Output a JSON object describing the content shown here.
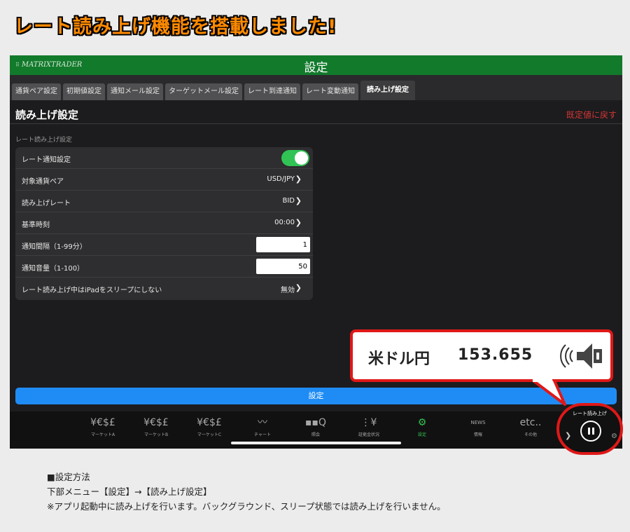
{
  "headline": "レート読み上げ機能を搭載しました!",
  "app": {
    "logo": "MATRIXTRADER",
    "title": "設定"
  },
  "tabs": [
    {
      "label": "通貨ペア設定"
    },
    {
      "label": "初期値設定"
    },
    {
      "label": "通知メール設定"
    },
    {
      "label": "ターゲットメール設定"
    },
    {
      "label": "レート到達通知"
    },
    {
      "label": "レート変動通知"
    },
    {
      "label": "読み上げ設定"
    }
  ],
  "section": {
    "title": "読み上げ設定",
    "reset_label": "既定値に戻す",
    "subheading": "レート読み上げ設定"
  },
  "settings": {
    "notify": {
      "label": "レート通知設定",
      "on": true
    },
    "pair": {
      "label": "対象通貨ペア",
      "value": "USD/JPY"
    },
    "rate": {
      "label": "読み上げレート",
      "value": "BID"
    },
    "base_time": {
      "label": "基準時刻",
      "value": "00:00"
    },
    "interval": {
      "label": "通知間隔（1-99分）",
      "value": "1"
    },
    "volume": {
      "label": "通知音量（1-100）",
      "value": "50"
    },
    "sleep": {
      "label": "レート読み上げ中はiPadをスリープにしない",
      "value": "無効"
    }
  },
  "save_label": "設定",
  "bottom_nav": [
    {
      "icon": "¥€$£",
      "label": "マーケットA",
      "icon_name": "currency-icon"
    },
    {
      "icon": "¥€$£",
      "label": "マーケットB",
      "icon_name": "currency-icon"
    },
    {
      "icon": "¥€$£",
      "label": "マーケットC",
      "icon_name": "currency-icon"
    },
    {
      "icon": "〰",
      "label": "チャート",
      "icon_name": "chart-icon"
    },
    {
      "icon": "▪▪Q",
      "label": "照会",
      "icon_name": "search-icon"
    },
    {
      "icon": "⋮¥",
      "label": "証拠金状況",
      "icon_name": "margin-icon"
    },
    {
      "icon": "⚙",
      "label": "設定",
      "icon_name": "gear-icon"
    },
    {
      "icon": "NEWS",
      "label": "情報",
      "icon_name": "news-icon"
    },
    {
      "icon": "etc..",
      "label": "その他",
      "icon_name": "more-icon"
    }
  ],
  "callout": {
    "pair": "米ドル円",
    "rate": "153.655"
  },
  "widget": {
    "label": "レート読み上げ"
  },
  "instructions": {
    "heading": "■設定方法",
    "path": "下部メニュー【設定】→【読み上げ設定】",
    "note": "※アプリ起動中に読み上げを行います。バックグラウンド、スリープ状態では読み上げを行いません。"
  },
  "colors": {
    "titlebar": "#127a2b",
    "accent": "#1f8cf5",
    "toggle_on": "#31c455",
    "reset": "#d43535",
    "callout_border": "#e01818",
    "headline": "#ff8a00"
  }
}
